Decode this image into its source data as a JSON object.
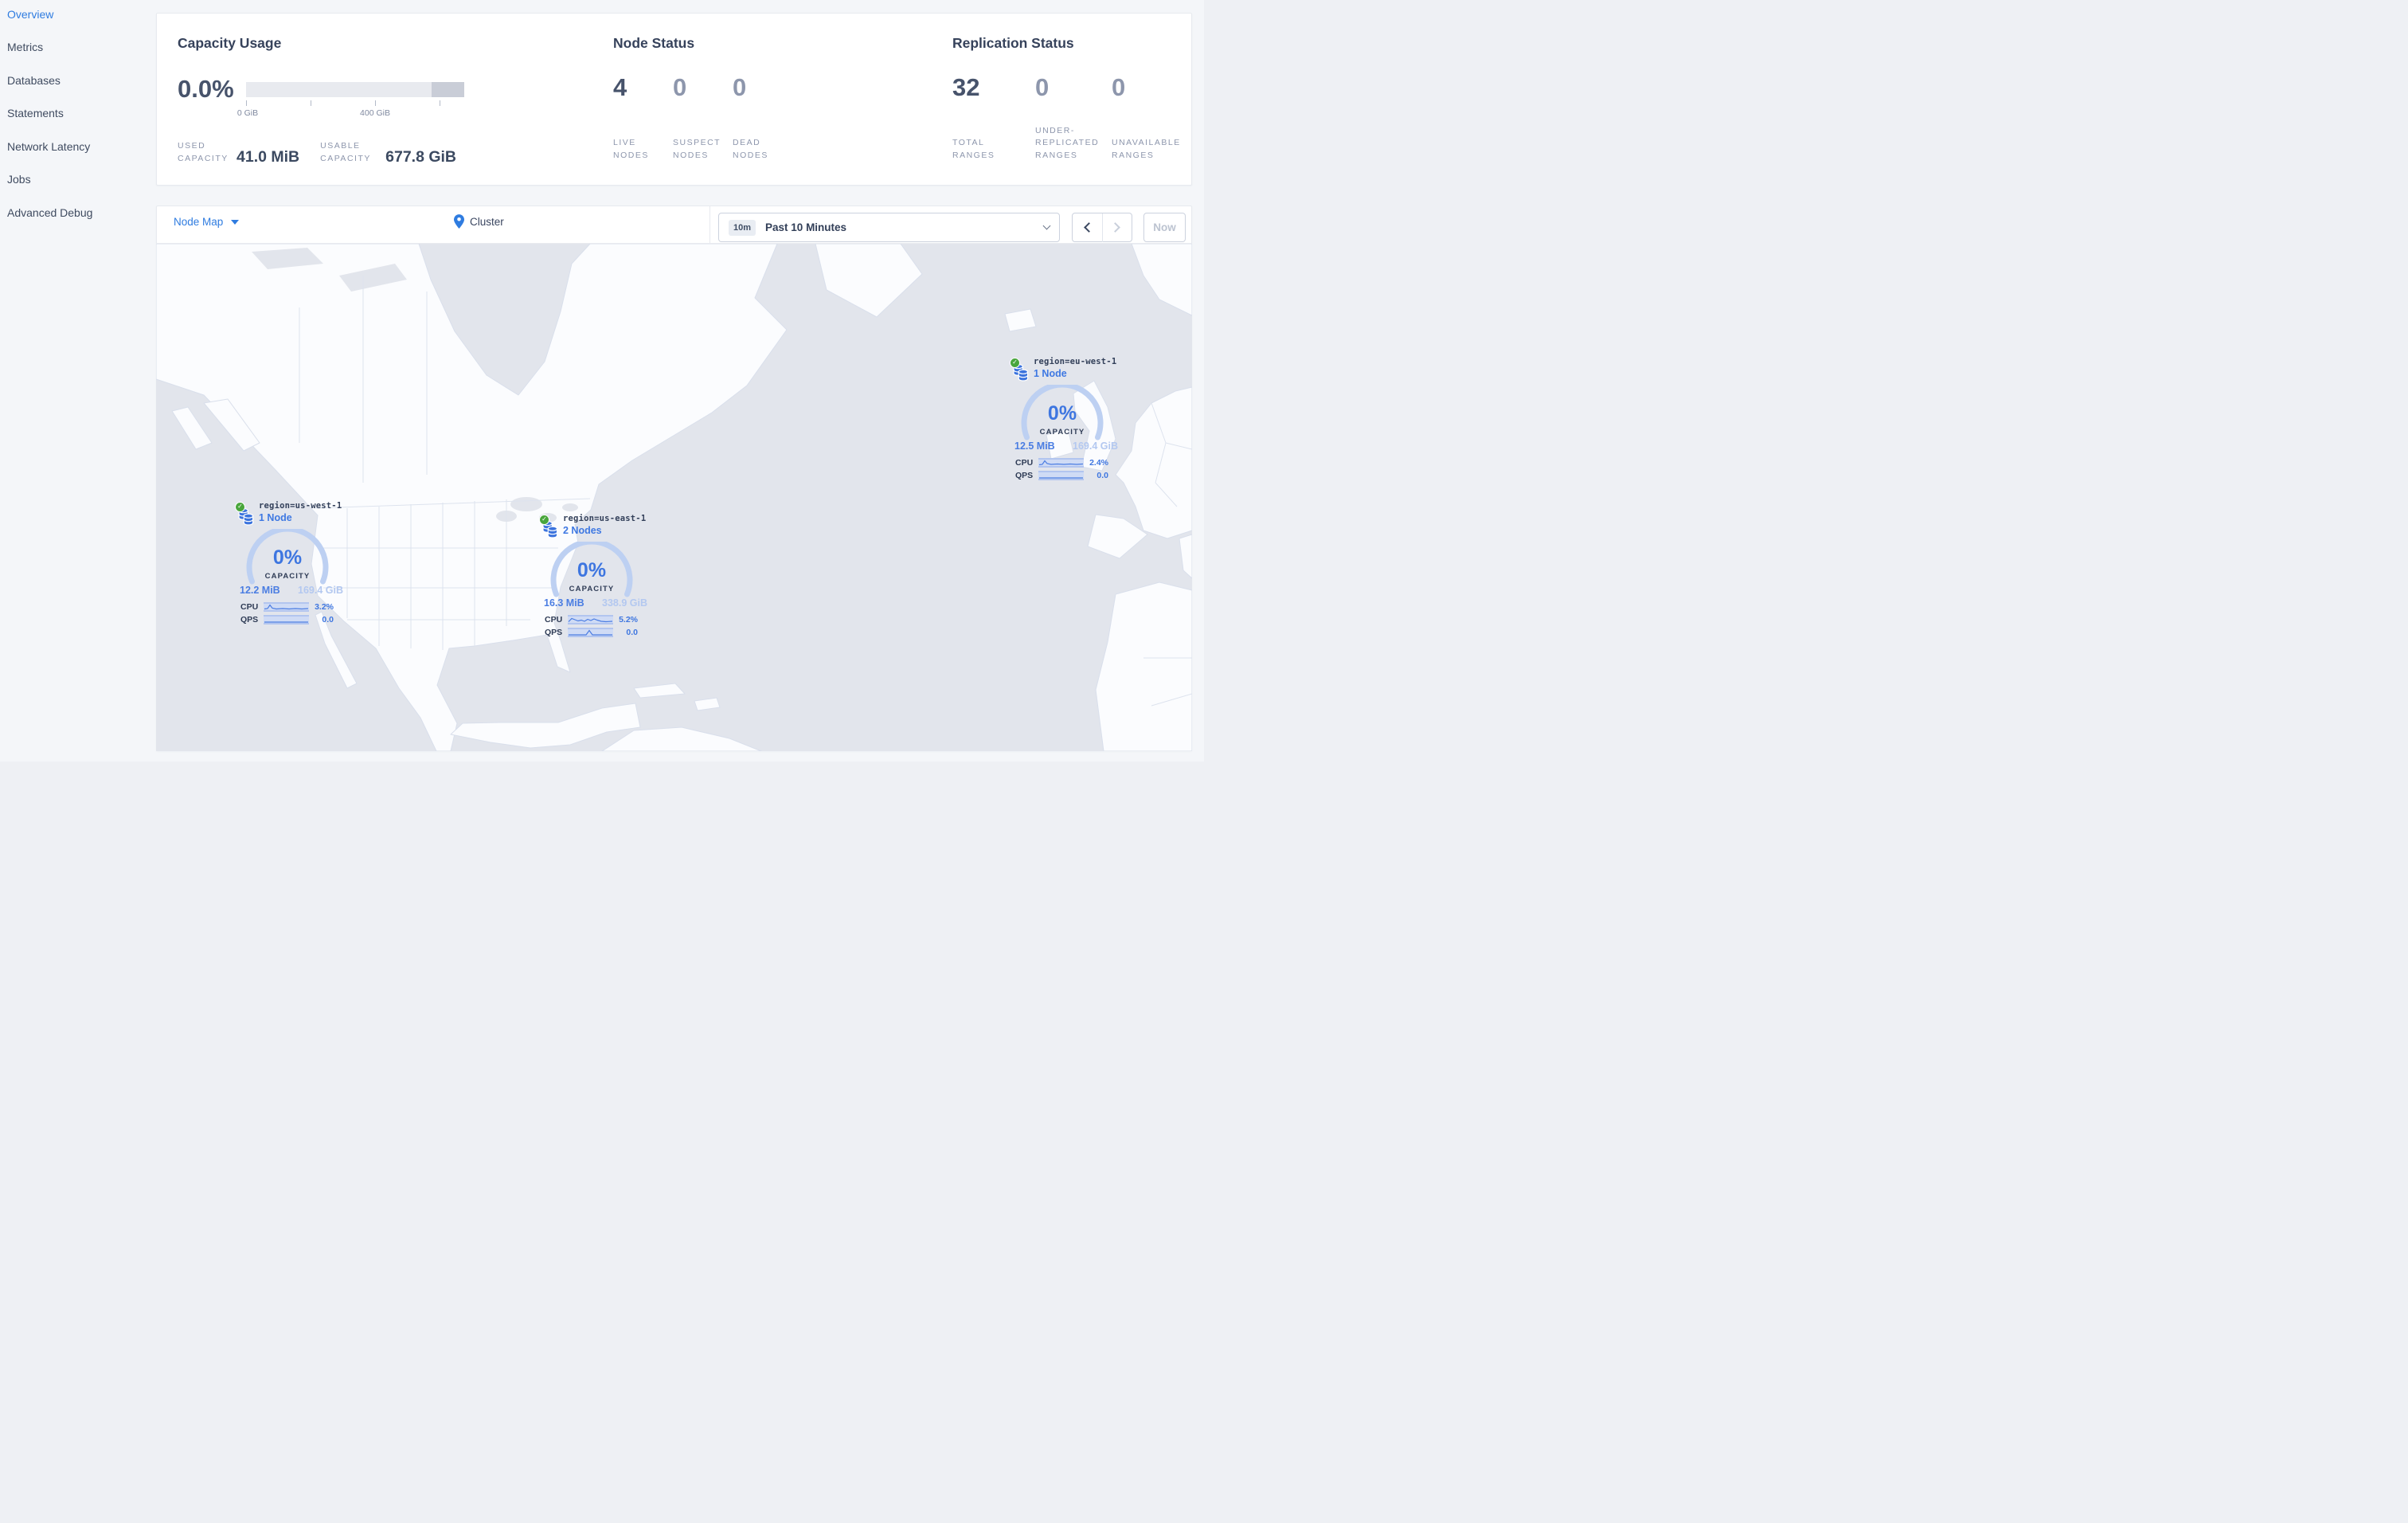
{
  "sidebar": {
    "items": [
      {
        "label": "Overview",
        "active": true
      },
      {
        "label": "Metrics",
        "active": false
      },
      {
        "label": "Databases",
        "active": false
      },
      {
        "label": "Statements",
        "active": false
      },
      {
        "label": "Network Latency",
        "active": false
      },
      {
        "label": "Jobs",
        "active": false
      },
      {
        "label": "Advanced Debug",
        "active": false
      }
    ]
  },
  "summary": {
    "capacity": {
      "title": "Capacity Usage",
      "percent": "0.0%",
      "tick_start": "0 GiB",
      "tick_mid": "400 GiB",
      "used_label": "USED CAPACITY",
      "used_value": "41.0 MiB",
      "usable_label": "USABLE CAPACITY",
      "usable_value": "677.8 GiB"
    },
    "node_status": {
      "title": "Node Status",
      "live_value": "4",
      "live_label": "LIVE NODES",
      "suspect_value": "0",
      "suspect_label": "SUSPECT NODES",
      "dead_value": "0",
      "dead_label": "DEAD NODES"
    },
    "replication": {
      "title": "Replication Status",
      "total_value": "32",
      "total_label": "TOTAL RANGES",
      "under_value": "0",
      "under_label": "UNDER-REPLICATED RANGES",
      "unavailable_value": "0",
      "unavailable_label": "UNAVAILABLE RANGES"
    }
  },
  "toolbar": {
    "view": "Node Map",
    "breadcrumb": "Cluster",
    "time_badge": "10m",
    "time_range": "Past 10 Minutes",
    "now": "Now"
  },
  "map": {
    "nodes": [
      {
        "region": "region=us-west-1",
        "count": "1 Node",
        "percent": "0%",
        "capacity_label": "CAPACITY",
        "used": "12.2 MiB",
        "usable": "169.4 GiB",
        "cpu_label": "CPU",
        "cpu": "3.2%",
        "qps_label": "QPS",
        "qps": "0.0"
      },
      {
        "region": "region=us-east-1",
        "count": "2 Nodes",
        "percent": "0%",
        "capacity_label": "CAPACITY",
        "used": "16.3 MiB",
        "usable": "338.9 GiB",
        "cpu_label": "CPU",
        "cpu": "5.2%",
        "qps_label": "QPS",
        "qps": "0.0"
      },
      {
        "region": "region=eu-west-1",
        "count": "1 Node",
        "percent": "0%",
        "capacity_label": "CAPACITY",
        "used": "12.5 MiB",
        "usable": "169.4 GiB",
        "cpu_label": "CPU",
        "cpu": "2.4%",
        "qps_label": "QPS",
        "qps": "0.0"
      }
    ]
  },
  "colors": {
    "accent": "#2f7ce0",
    "heading": "#36425b",
    "muted": "#8d96ac",
    "green": "#49a63c",
    "gauge_arc": "#bdd0f2",
    "node_blue": "#4a7de2",
    "ocean": "#e2e5ec",
    "land": "#fbfcfe"
  }
}
